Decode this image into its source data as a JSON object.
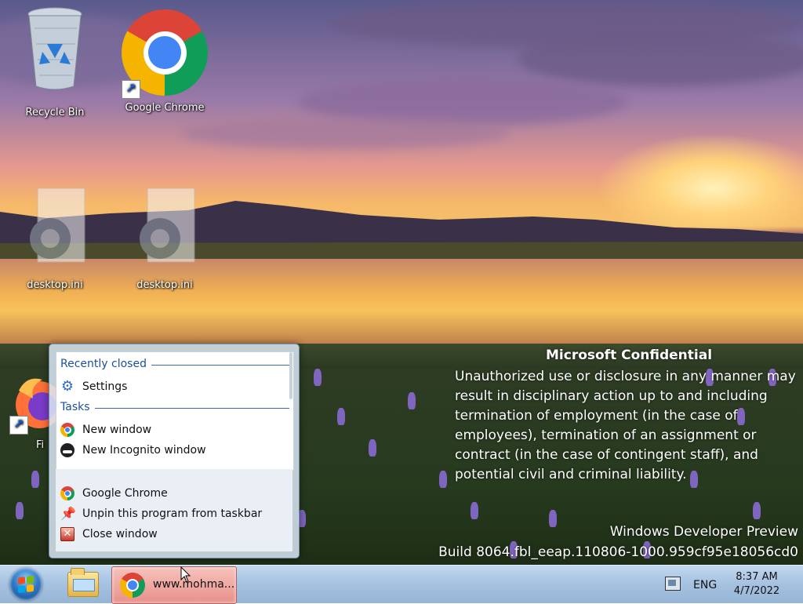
{
  "desktop": {
    "icons": [
      {
        "label": "Recycle Bin",
        "icon": "recycle-bin-icon"
      },
      {
        "label": "Google Chrome",
        "icon": "chrome-icon"
      },
      {
        "label": "desktop.ini",
        "icon": "settings-file-icon"
      },
      {
        "label": "desktop.ini",
        "icon": "settings-file-icon"
      },
      {
        "label": "Fi",
        "icon": "firefox-icon"
      }
    ]
  },
  "watermark": {
    "title": "Microsoft Confidential",
    "body": "Unauthorized use or disclosure in any manner may result in disciplinary action up to and including termination of employment (in the case of employees), termination of an assignment or contract (in the case of contingent staff), and potential civil and criminal liability.",
    "edition": "Windows Developer Preview",
    "build": "Build 8064.fbl_eeap.110806-1000.959cf95e18056cd0"
  },
  "jumplist": {
    "recent_heading": "Recently closed",
    "recent_items": [
      {
        "label": "Settings",
        "icon": "gear-icon"
      }
    ],
    "tasks_heading": "Tasks",
    "task_items": [
      {
        "label": "New window",
        "icon": "chrome-icon"
      },
      {
        "label": "New Incognito window",
        "icon": "incognito-icon"
      }
    ],
    "program_items": [
      {
        "label": "Google Chrome",
        "icon": "chrome-icon"
      },
      {
        "label": "Unpin this program from taskbar",
        "icon": "unpin-icon"
      },
      {
        "label": "Close window",
        "icon": "close-icon"
      }
    ]
  },
  "taskbar": {
    "chrome_button_label": "www.mohma...",
    "language": "ENG",
    "time": "8:37 AM",
    "date": "4/7/2022"
  },
  "colors": {
    "accent_blue": "#1e4e9c",
    "taskbar_active": "#e9908a"
  }
}
